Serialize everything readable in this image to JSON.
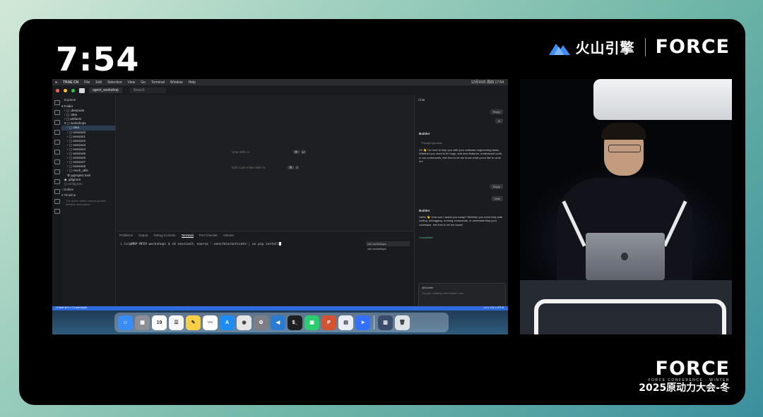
{
  "overlay": {
    "clock": "7:54",
    "brand_cn": "火山引擎",
    "brand_force": "FORCE",
    "corner_force": "FORCE",
    "corner_tagline": "FORCE CONFERENCE · WINTER",
    "corner_cn": "2025原动力大会-冬"
  },
  "menubar": {
    "app": "TRAE CN",
    "items": [
      "File",
      "Edit",
      "Selection",
      "View",
      "Go",
      "Terminal",
      "Window",
      "Help"
    ],
    "right": "12月16日 周四 17:54"
  },
  "titlebar": {
    "project": "agent_workshop",
    "search_placeholder": "Search"
  },
  "explorer": {
    "title": "Explorer",
    "root": "Folder",
    "rows": [
      ".deepnote",
      ".idea",
      "artifacts",
      "workshops",
      "data",
      "session0",
      "session1",
      "session2",
      "session3",
      "session4",
      "session5",
      "session6",
      "session7",
      "session8",
      "mock_utils",
      "pyproject.toml",
      ".gitignore",
      "config.json"
    ],
    "outline": "Outline",
    "timeline": "Timeline",
    "timeline_hint": "The active editor cannot provide timeline information."
  },
  "editor": {
    "shortcut1": "Chat With AI",
    "shortcut1_keys": [
      "⌘",
      "U"
    ],
    "shortcut2": "Edit Code Inline With AI",
    "shortcut2_keys": [
      "⌘",
      "I"
    ]
  },
  "panel": {
    "tabs": [
      "Problems",
      "Output",
      "Debug Console",
      "Terminal",
      "Port Checker",
      "Volume"
    ],
    "active_tab": "Terminal",
    "prompt": "(.lo)@MBP-MFE9 workshops $",
    "command": "cd session3; source '.venv/bin/activate'; uv pip install",
    "terminals": [
      "zsh workshops",
      "zsh workshops"
    ]
  },
  "chat": {
    "title": "Chat",
    "user1": "Reply",
    "user1_sub": "hi",
    "bot_name": "Builder",
    "thought": "Thought process",
    "bot_msg1": "Hi! 👋 I'm here to help you with your software engineering tasks. Whether you need to fix bugs, add new features, understand code, or run commands, feel free to let me know what you'd like to work on!",
    "user2": "Reply",
    "user2_sub": "hello",
    "bot_msg2": "Hello! 👋 How can I assist you today? Whether you need help with coding, debugging, running commands, or understanding your codebase, feel free to let me know!",
    "status": "Completed",
    "input_tag": "@Builder",
    "input_placeholder": "You are chatting with Builder now",
    "model": "Doubao-Seed-1.6"
  },
  "statusbar": {
    "left": "⎇ main  ⊗ 0 ⚠ 0  Launchpad",
    "right": "Ln 1, Col 1  UTF-8"
  },
  "dock": {
    "apps": [
      {
        "name": "finder",
        "color": "#3a8df5",
        "glyph": "☺"
      },
      {
        "name": "launchpad",
        "color": "#8e8f95",
        "glyph": "▦"
      },
      {
        "name": "calendar",
        "color": "#ffffff",
        "glyph": "19"
      },
      {
        "name": "reminders",
        "color": "#f5f5f5",
        "glyph": "☰"
      },
      {
        "name": "notes",
        "color": "#f7d048",
        "glyph": "✎"
      },
      {
        "name": "freeform",
        "color": "#ffffff",
        "glyph": "〰"
      },
      {
        "name": "app-store",
        "color": "#1d8cf5",
        "glyph": "A"
      },
      {
        "name": "chrome",
        "color": "#e5e5e5",
        "glyph": "◉"
      },
      {
        "name": "settings",
        "color": "#7c7f85",
        "glyph": "⚙"
      },
      {
        "name": "vscode",
        "color": "#2b7bd3",
        "glyph": "◀"
      },
      {
        "name": "terminal",
        "color": "#1f1f1f",
        "glyph": "$_"
      },
      {
        "name": "trae",
        "color": "#2ecc71",
        "glyph": "▣"
      },
      {
        "name": "powerpoint",
        "color": "#d35230",
        "glyph": "P"
      },
      {
        "name": "preview",
        "color": "#e9eef5",
        "glyph": "▤"
      },
      {
        "name": "feishu",
        "color": "#3370ff",
        "glyph": "➤"
      },
      {
        "name": "downloads",
        "color": "#3b4b6b",
        "glyph": "▥"
      },
      {
        "name": "trash",
        "color": "#dfe3e8",
        "glyph": "🗑"
      }
    ]
  }
}
